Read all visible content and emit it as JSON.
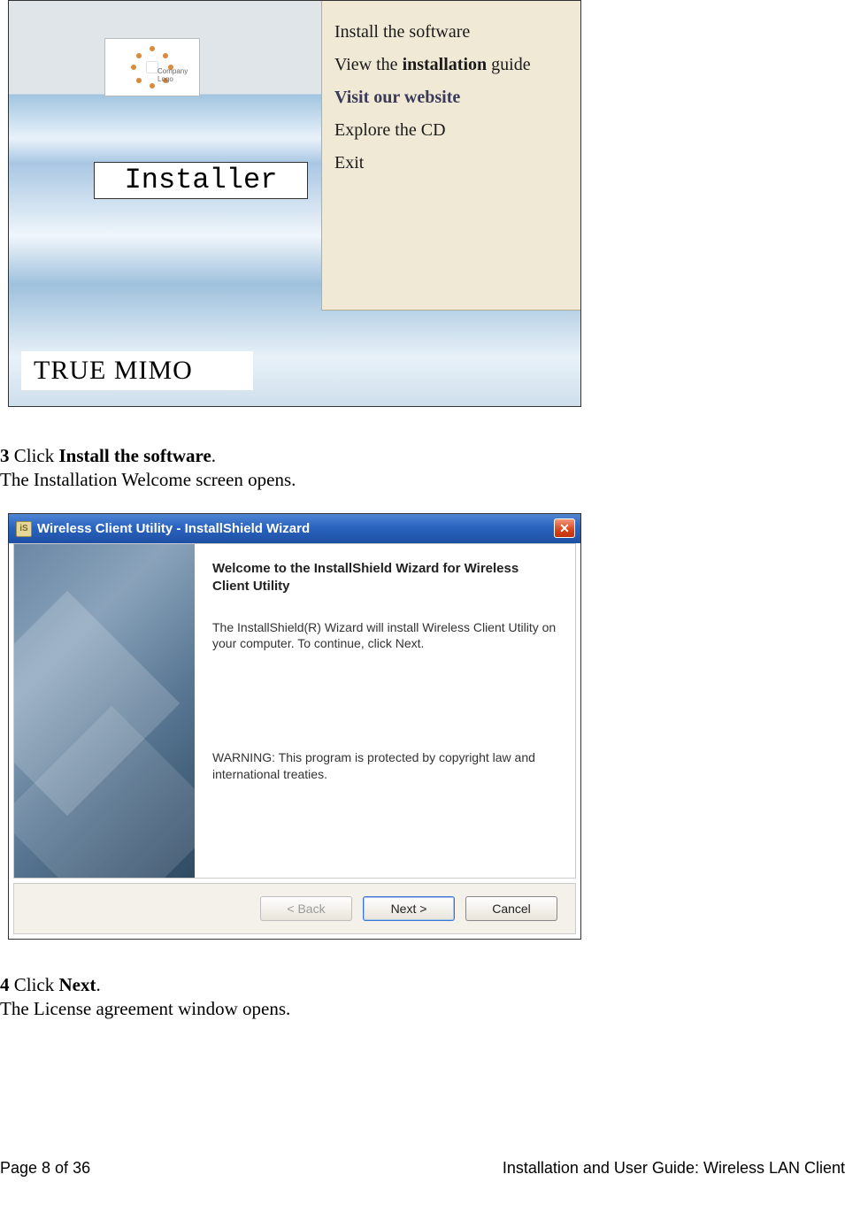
{
  "figure1": {
    "logo_text": "Company Logo",
    "installer_label": "Installer",
    "true_mimo": "TRUE MIMO",
    "menu": {
      "install": "Install the software",
      "guide_pre": "View the ",
      "guide_bold": "installation",
      "guide_post": " guide",
      "visit_pre": "Visit ",
      "visit_bold": "our website",
      "explore": "Explore the CD",
      "exit": "Exit"
    }
  },
  "step3": {
    "num": "3",
    "action_pre": " Click ",
    "action_bold": "Install the software",
    "action_post": ".",
    "line2": "The Installation Welcome screen opens."
  },
  "figure2": {
    "title": "Wireless Client Utility - InstallShield Wizard",
    "title_icon": "iS",
    "close_glyph": "✕",
    "heading": "Welcome to the InstallShield Wizard for Wireless Client Utility",
    "p1": "The InstallShield(R) Wizard will install Wireless Client Utility on your computer. To continue, click Next.",
    "p2": "WARNING: This program is protected by copyright law and international treaties.",
    "buttons": {
      "back": "< Back",
      "next": "Next >",
      "cancel": "Cancel"
    }
  },
  "step4": {
    "num": "4",
    "action_pre": " Click ",
    "action_bold": "Next",
    "action_post": ".",
    "line2": "The License agreement window opens."
  },
  "footer": {
    "left": "Page 8 of 36",
    "right": "Installation and User Guide: Wireless LAN Client"
  }
}
